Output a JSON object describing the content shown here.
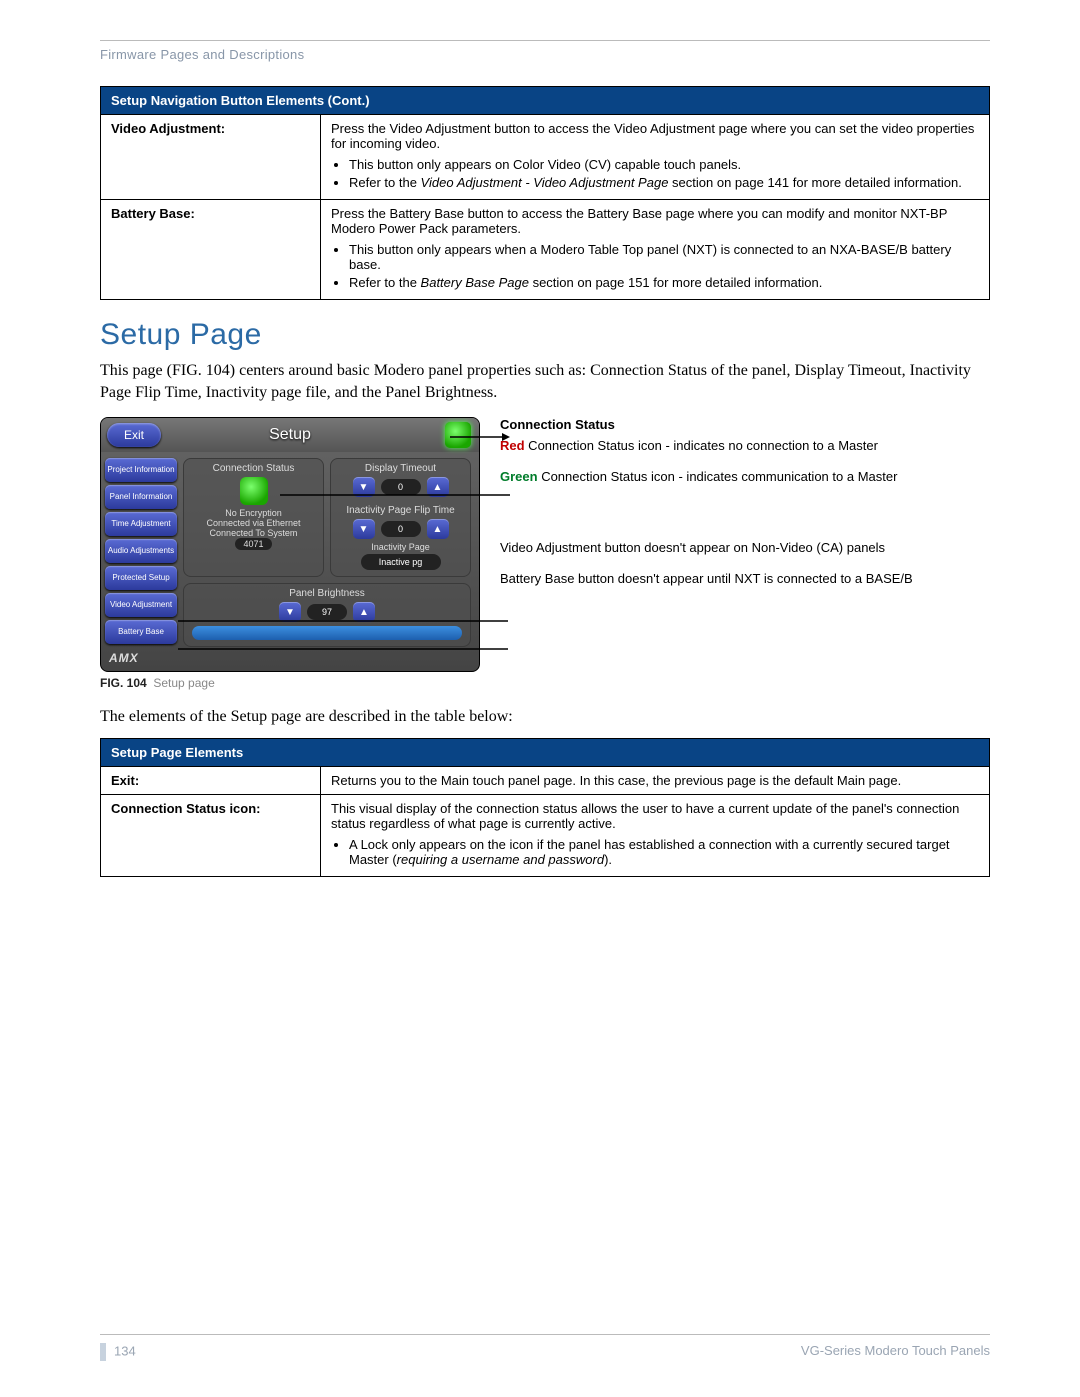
{
  "header": {
    "breadcrumb": "Firmware Pages and Descriptions"
  },
  "table1": {
    "heading": "Setup Navigation Button Elements (Cont.)",
    "rows": [
      {
        "label": "Video Adjustment:",
        "para": "Press the Video Adjustment button to access the Video Adjustment page where you can set the video properties for incoming video.",
        "bullets": [
          "This button only appears on Color Video (CV) capable touch panels.",
          "Refer to the Video Adjustment - Video Adjustment Page section on page 141 for more detailed information."
        ]
      },
      {
        "label": "Battery Base:",
        "para": "Press the Battery Base button to access the Battery Base page where you can modify and monitor NXT-BP Modero Power Pack parameters.",
        "bullets": [
          "This button only appears when a Modero Table Top panel (NXT) is connected to an NXA-BASE/B battery base.",
          "Refer to the Battery Base Page section on page 151 for more detailed information."
        ]
      }
    ]
  },
  "heading": "Setup Page",
  "intro": "This page (FIG. 104) centers around basic Modero panel properties such as: Connection Status of the panel, Display Timeout, Inactivity Page Flip Time, Inactivity page file, and the Panel Brightness.",
  "panel": {
    "exit": "Exit",
    "title": "Setup",
    "sidebar": [
      "Project Information",
      "Panel Information",
      "Time Adjustment",
      "Audio Adjustments",
      "Protected Setup",
      "Video Adjustment",
      "Battery Base"
    ],
    "groups": {
      "conn": {
        "title": "Connection Status",
        "l1": "No Encryption",
        "l2": "Connected via Ethernet",
        "l3a": "Connected To System",
        "l3b": "4071"
      },
      "disp": {
        "title": "Display Timeout",
        "val": "0"
      },
      "inact": {
        "title": "Inactivity Page Flip Time",
        "val": "0",
        "sub": "Inactivity Page",
        "page": "Inactive pg"
      },
      "bright": {
        "title": "Panel Brightness",
        "val": "97"
      }
    },
    "logo": "AMX"
  },
  "annotations": {
    "title": "Connection Status",
    "red_lead": "Red",
    "red_rest": " Connection Status icon - indicates no connection to a Master",
    "green_lead": "Green",
    "green_rest": " Connection Status icon - indicates communication to a Master",
    "note1": "Video Adjustment button doesn't appear on Non-Video (CA) panels",
    "note2": "Battery Base button doesn't appear until NXT is connected to a BASE/B"
  },
  "fig": {
    "num": "FIG. 104",
    "caption": "Setup page"
  },
  "lead2": "The elements of the Setup page are described in the table below:",
  "table2": {
    "heading": "Setup Page Elements",
    "rows": [
      {
        "label": "Exit:",
        "para": "Returns you to the Main touch panel page. In this case, the previous page is the default Main page."
      },
      {
        "label": "Connection Status icon:",
        "para": "This visual display of the connection status allows the user to have a current update of the panel's connection status regardless of what page is currently active.",
        "bullets": [
          "A Lock only appears on the icon if the panel has established a connection with a currently secured target Master (requiring a username and password)."
        ]
      }
    ]
  },
  "footer": {
    "page": "134",
    "doc": "VG-Series Modero Touch Panels"
  }
}
